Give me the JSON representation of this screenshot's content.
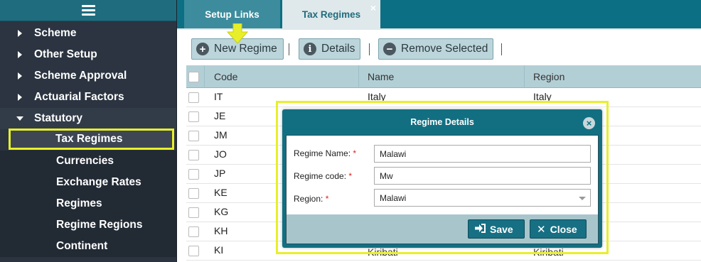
{
  "sidebar": {
    "items": [
      {
        "label": "Scheme"
      },
      {
        "label": "Other Setup"
      },
      {
        "label": "Scheme Approval"
      },
      {
        "label": "Actuarial Factors"
      },
      {
        "label": "Statutory"
      }
    ],
    "sub_items": [
      {
        "label": "Tax Regimes"
      },
      {
        "label": "Currencies"
      },
      {
        "label": "Exchange Rates"
      },
      {
        "label": "Regimes"
      },
      {
        "label": "Regime Regions"
      },
      {
        "label": "Continent"
      }
    ]
  },
  "tabs": [
    {
      "label": "Setup Links"
    },
    {
      "label": "Tax Regimes",
      "close": "×"
    }
  ],
  "toolbar": {
    "new_label": "New Regime",
    "details_label": "Details",
    "remove_label": "Remove Selected"
  },
  "table": {
    "columns": [
      "Code",
      "Name",
      "Region"
    ],
    "rows": [
      {
        "code": "IT",
        "name": "Italy",
        "region": "Italy"
      },
      {
        "code": "JE",
        "name": "",
        "region": ""
      },
      {
        "code": "JM",
        "name": "",
        "region": ""
      },
      {
        "code": "JO",
        "name": "",
        "region": ""
      },
      {
        "code": "JP",
        "name": "",
        "region": ""
      },
      {
        "code": "KE",
        "name": "",
        "region": ""
      },
      {
        "code": "KG",
        "name": "",
        "region": ""
      },
      {
        "code": "KH",
        "name": "",
        "region": ""
      },
      {
        "code": "KI",
        "name": "Kiribati",
        "region": "Kiribati"
      }
    ]
  },
  "modal": {
    "title": "Regime Details",
    "close": "×",
    "fields": {
      "name_label": "Regime Name:",
      "name_value": "Malawi",
      "code_label": "Regime code:",
      "code_value": "Mw",
      "region_label": "Region:",
      "region_value": "Malawi",
      "required_mark": "*"
    },
    "save_label": "Save",
    "close_label": "Close"
  },
  "colors": {
    "accent": "#126f82",
    "highlight": "#e8ef2a",
    "sidebar_bg": "#2b3440"
  }
}
